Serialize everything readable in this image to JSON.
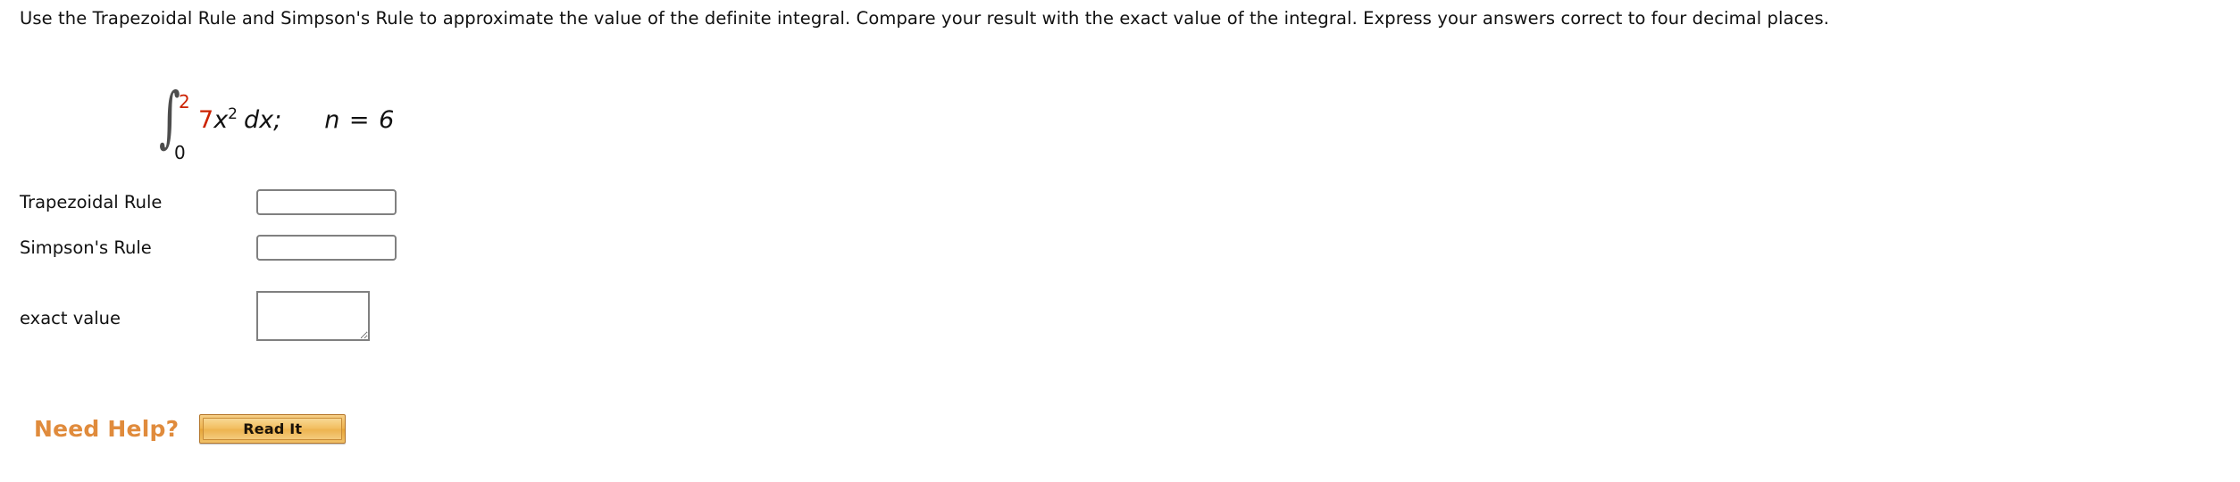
{
  "prompt": {
    "text": "Use the Trapezoidal Rule and Simpson's Rule to approximate the value of the definite integral. Compare your result with the exact value of the integral. Express your answers correct to four decimal places."
  },
  "integral": {
    "symbol": "∫",
    "upper_limit": "2",
    "lower_limit": "0",
    "coefficient": "7",
    "variable": "x",
    "exponent": "2",
    "differential": "dx;",
    "n_value": "n = 6",
    "upper_limit_color": "#cc2200",
    "coefficient_color": "#cc2200",
    "lower_limit_color": "#111111"
  },
  "answers": {
    "rows": [
      {
        "label": "Trapezoidal Rule",
        "value": "",
        "placeholder": ""
      },
      {
        "label": "Simpson's Rule",
        "value": "",
        "placeholder": ""
      },
      {
        "label": "exact value",
        "value": "",
        "placeholder": ""
      }
    ]
  },
  "help": {
    "title": "Need Help?",
    "button_label": "Read It",
    "title_color": "#e08b3c",
    "button_color": "#eeb44f"
  }
}
